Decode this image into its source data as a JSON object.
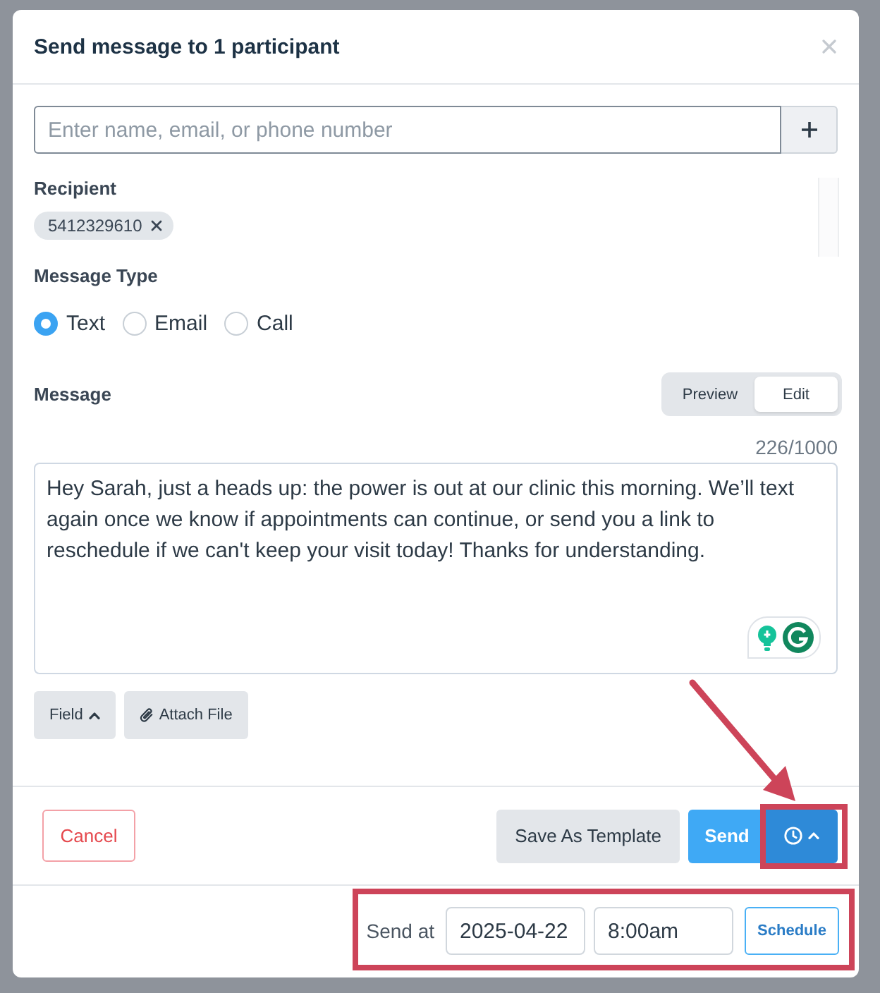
{
  "dialog": {
    "title": "Send message to 1 participant"
  },
  "recipient_search": {
    "placeholder": "Enter name, email, or phone number"
  },
  "recipient": {
    "label": "Recipient",
    "chips": [
      {
        "text": "5412329610"
      }
    ]
  },
  "message_type": {
    "label": "Message Type",
    "options": [
      {
        "label": "Text",
        "selected": true
      },
      {
        "label": "Email",
        "selected": false
      },
      {
        "label": "Call",
        "selected": false
      }
    ]
  },
  "message": {
    "label": "Message",
    "modes": [
      {
        "label": "Preview",
        "selected": false
      },
      {
        "label": "Edit",
        "selected": true
      }
    ],
    "counter": "226/1000",
    "value": "Hey Sarah, just a heads up: the power is out at our clinic this morning. We’ll text again once we know if appointments can continue, or send you a link to reschedule if we can't keep your visit today! Thanks for understanding."
  },
  "tools": [
    {
      "label": "Field",
      "kind": "menu"
    },
    {
      "label": "Attach File",
      "kind": "attach"
    }
  ],
  "footer": {
    "cancel": "Cancel",
    "save_template": "Save As Template",
    "send": "Send",
    "schedule_toggle": {
      "expanded": true
    }
  },
  "schedule": {
    "label": "Send at",
    "date": "2025-04-22",
    "time": "8:00am",
    "button": "Schedule"
  }
}
